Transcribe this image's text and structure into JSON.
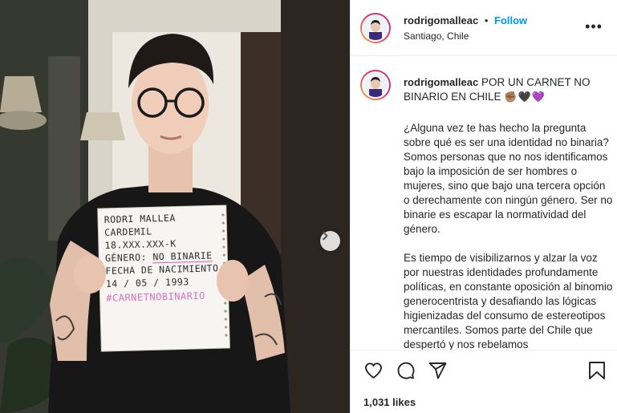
{
  "post": {
    "username": "rodrigomalleac",
    "separator": "•",
    "follow_label": "Follow",
    "location": "Santiago, Chile",
    "more_label": "•••",
    "caption_title": "POR UN CARNET NO BINARIO EN CHILE",
    "caption_emoji": "✊🏽🖤💜",
    "caption_paragraphs": [
      "¿Alguna vez te has hecho la pregunta sobre qué es ser una identidad no binaria? Somos personas que no nos identificamos bajo la imposición de ser hombres o mujeres, sino que bajo una tercera opción o derechamente con ningún género. Ser no binarie es escapar la normatividad del género.",
      "Es tiempo de visibilizarnos y alzar la voz por nuestras identidades profundamente políticas, en constante oposición al binomio generocentrista y desafiando las lógicas higienizadas del consumo de estereotipos mercantiles. Somos parte del Chile que despertó y nos rebelamos"
    ],
    "likes_text": "1,031 likes"
  },
  "card": {
    "line1": "RODRI MALLEA",
    "line2": "CARDEMIL",
    "line3": "18.XXX.XXX-K",
    "line4_label": "GÉNERO:",
    "line4_value": "NO BINARIE",
    "line5": "FECHA DE NACIMIENTO",
    "line6": "14 / 05 / 1993",
    "hashtag": "#CARNETNOBINARIO"
  },
  "icons": {
    "like": "heart-icon",
    "comment": "comment-icon",
    "share": "share-icon",
    "save": "bookmark-icon",
    "next": "chevron-right-icon",
    "more": "more-options-icon"
  },
  "colors": {
    "follow": "#0095f6",
    "border": "#efefef",
    "text": "#262626",
    "hashtag": "#d96fc1"
  }
}
